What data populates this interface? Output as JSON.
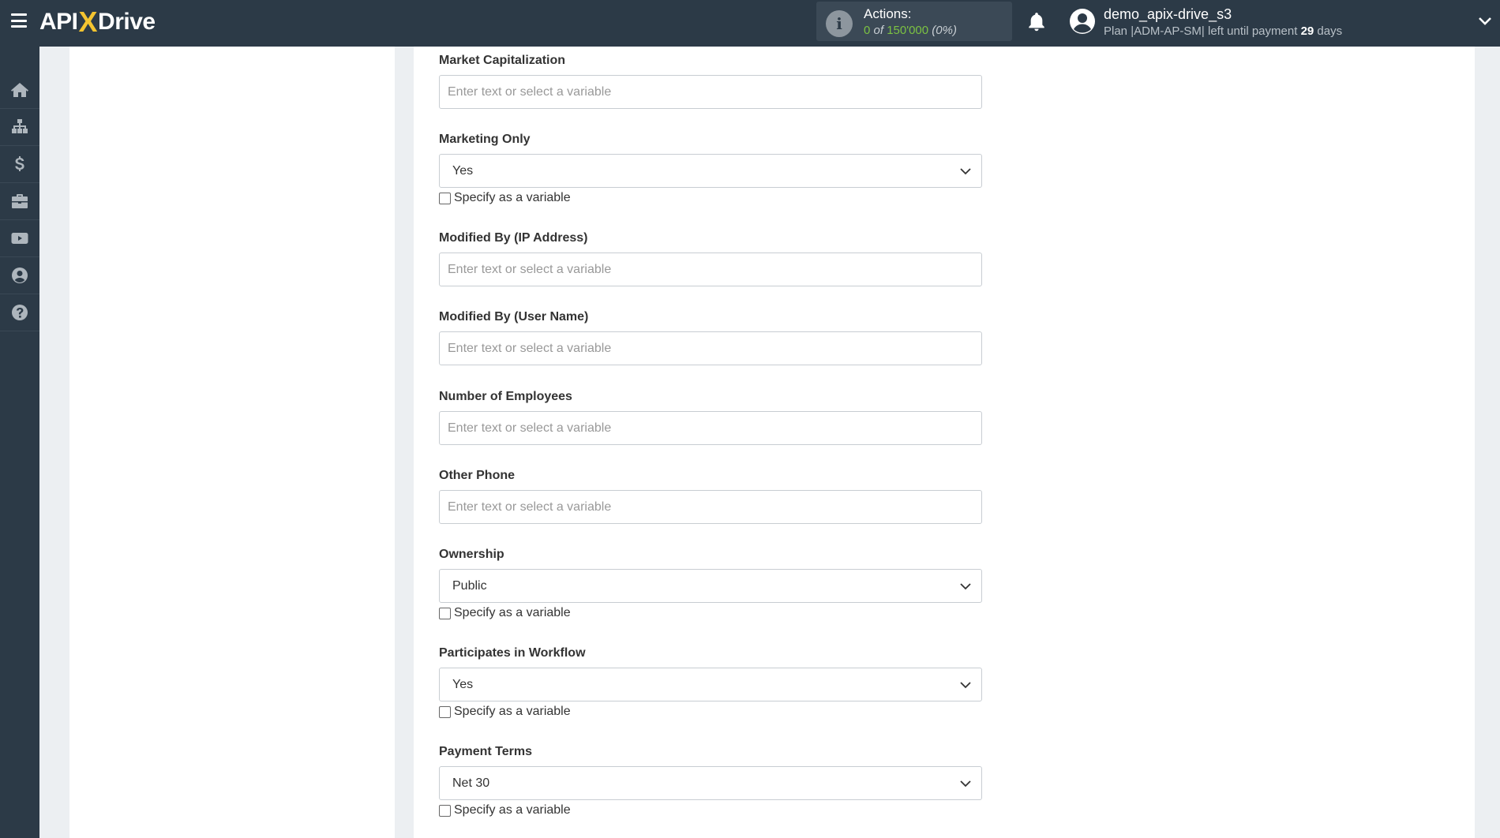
{
  "app": {
    "logo_left": "API",
    "logo_x": "X",
    "logo_right": "Drive"
  },
  "header": {
    "actions_label": "Actions:",
    "actions_used": "0",
    "actions_of": "of",
    "actions_total": "150'000",
    "actions_pct": "(0%)",
    "user_name": "demo_apix-drive_s3",
    "plan_prefix": "Plan |ADM-AP-SM| left until payment",
    "plan_days": "29",
    "plan_suffix": "days"
  },
  "sidebar": {
    "items": [
      {
        "name": "home-icon"
      },
      {
        "name": "sitemap-icon"
      },
      {
        "name": "dollar-icon"
      },
      {
        "name": "briefcase-icon"
      },
      {
        "name": "youtube-icon"
      },
      {
        "name": "user-icon"
      },
      {
        "name": "help-icon"
      }
    ]
  },
  "form": {
    "checkbox_label": "Specify as a variable",
    "placeholder": "Enter text or select a variable",
    "fields": [
      {
        "label": "Market Capitalization",
        "type": "text"
      },
      {
        "label": "Marketing Only",
        "type": "select",
        "value": "Yes"
      },
      {
        "label": "Modified By (IP Address)",
        "type": "text"
      },
      {
        "label": "Modified By (User Name)",
        "type": "text"
      },
      {
        "label": "Number of Employees",
        "type": "text"
      },
      {
        "label": "Other Phone",
        "type": "text"
      },
      {
        "label": "Ownership",
        "type": "select",
        "value": "Public"
      },
      {
        "label": "Participates in Workflow",
        "type": "select",
        "value": "Yes"
      },
      {
        "label": "Payment Terms",
        "type": "select",
        "value": "Net 30"
      }
    ]
  }
}
